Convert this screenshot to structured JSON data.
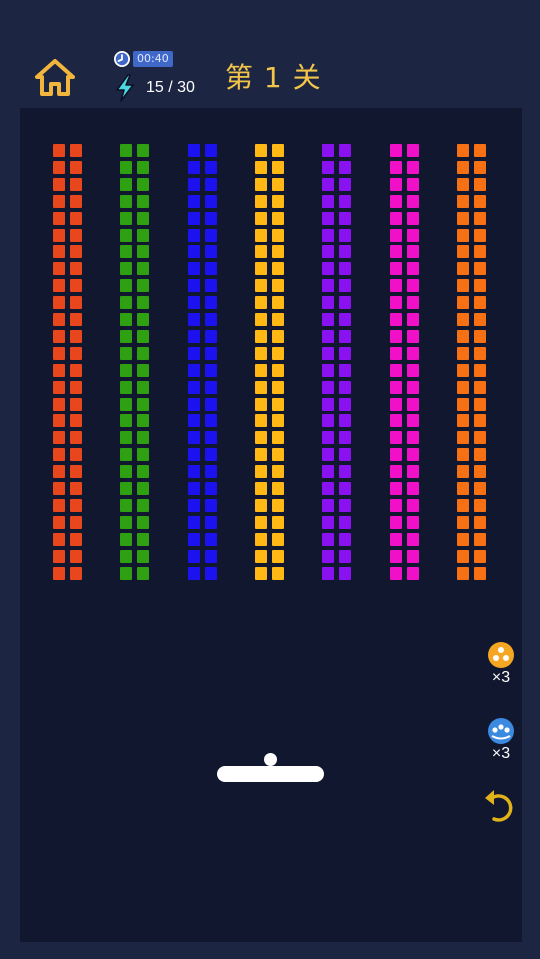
{
  "header": {
    "home_icon": "home-icon",
    "timer_icon": "clock-icon",
    "timer": "00:40",
    "energy_icon": "lightning-icon",
    "energy": "15 / 30",
    "level_title": "第 1 关"
  },
  "colors": {
    "background": "#1c2542",
    "board": "#11172e",
    "accent": "#f2c44a",
    "timer_pill": "#3f68c9"
  },
  "bricks": {
    "columns": [
      {
        "color": "#e8461c"
      },
      {
        "color": "#2fa012"
      },
      {
        "color": "#1c12f0"
      },
      {
        "color": "#ffb814"
      },
      {
        "color": "#8a12f0"
      },
      {
        "color": "#f010c8"
      },
      {
        "color": "#f87014"
      }
    ],
    "rows_per_column": 26,
    "bricks_per_row": 2
  },
  "powerups": [
    {
      "name": "split-ball-icon",
      "count": "×3",
      "color": "#f5a623"
    },
    {
      "name": "multi-ball-icon",
      "count": "×3",
      "color": "#3b8ae0"
    }
  ],
  "undo_icon": "undo-icon"
}
